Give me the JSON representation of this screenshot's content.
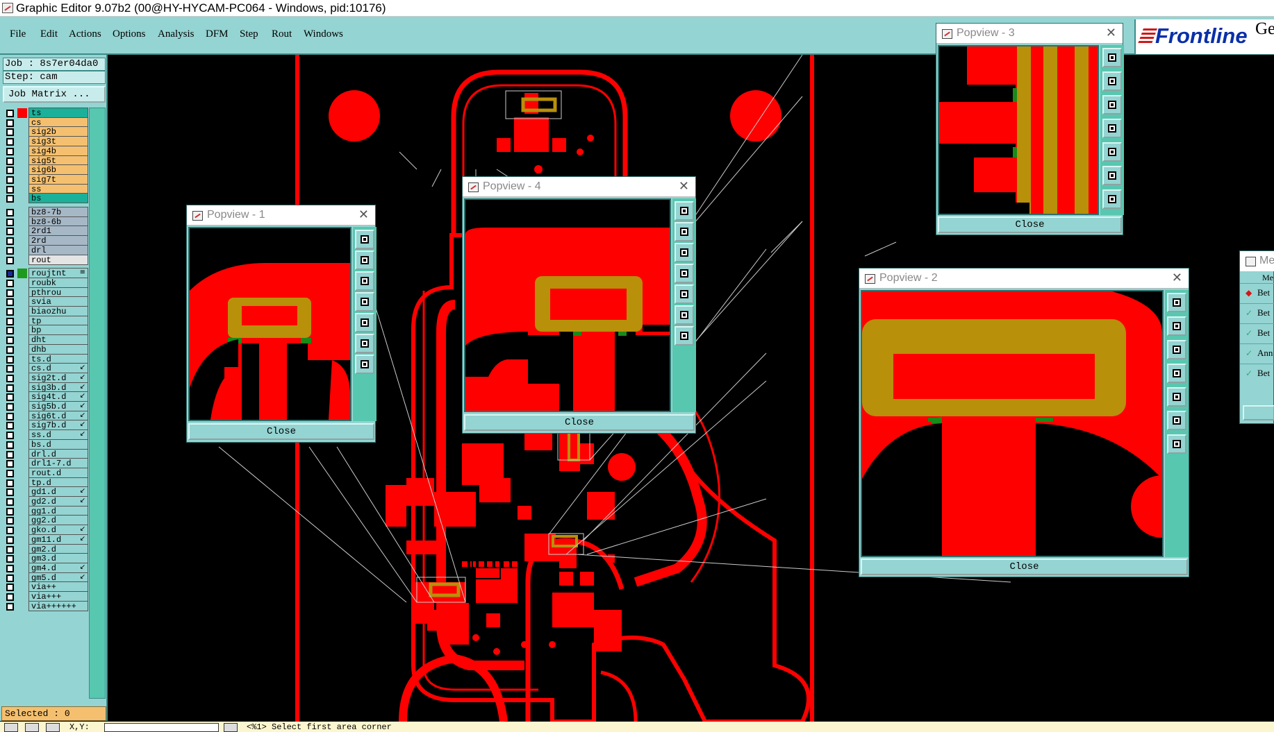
{
  "window": {
    "title": "Graphic Editor 9.07b2 (00@HY-HYCAM-PC064 - Windows, pid:10176)"
  },
  "menu": [
    {
      "label": "File"
    },
    {
      "label": "Edit"
    },
    {
      "label": "Actions"
    },
    {
      "label": "Options"
    },
    {
      "label": "Analysis"
    },
    {
      "label": "DFM"
    },
    {
      "label": "Step"
    },
    {
      "label": "Rout"
    },
    {
      "label": "Windows"
    }
  ],
  "brand": {
    "logo_text": "Frontline",
    "partial_text": "Ge"
  },
  "job": {
    "job_label": "Job : 8s7er04da0",
    "step_label": "Step: cam",
    "job_matrix_button": "Job Matrix ..."
  },
  "layers": [
    {
      "name": "ts",
      "color": "#1ab09a",
      "swatch": "#ff0000"
    },
    {
      "name": "cs",
      "color": "#f4c070",
      "swatch": ""
    },
    {
      "name": "sig2b",
      "color": "#f4c070",
      "swatch": ""
    },
    {
      "name": "sig3t",
      "color": "#f4c070",
      "swatch": ""
    },
    {
      "name": "sig4b",
      "color": "#f4c070",
      "swatch": ""
    },
    {
      "name": "sig5t",
      "color": "#f4c070",
      "swatch": ""
    },
    {
      "name": "sig6b",
      "color": "#f4c070",
      "swatch": ""
    },
    {
      "name": "sig7t",
      "color": "#f4c070",
      "swatch": ""
    },
    {
      "name": "ss",
      "color": "#f4c070",
      "swatch": ""
    },
    {
      "name": "bs",
      "color": "#1ab09a",
      "swatch": ""
    },
    {
      "name": "bz8-7b",
      "color": "#a6b8c6",
      "swatch": ""
    },
    {
      "name": "bz8-6b",
      "color": "#a6b8c6",
      "swatch": ""
    },
    {
      "name": "2rd1",
      "color": "#a6b8c6",
      "swatch": ""
    },
    {
      "name": "2rd",
      "color": "#a6b8c6",
      "swatch": ""
    },
    {
      "name": "drl",
      "color": "#a6b8c6",
      "swatch": ""
    },
    {
      "name": "rout",
      "color": "#e4e4e4",
      "swatch": ""
    },
    {
      "name": "roujtnt",
      "color": "#94d4d2",
      "swatch": "#1e9a1e",
      "mark": "≡",
      "checked": true
    },
    {
      "name": "roubk",
      "color": "#94d4d2",
      "swatch": ""
    },
    {
      "name": "pthrou",
      "color": "#94d4d2",
      "swatch": ""
    },
    {
      "name": "svia",
      "color": "#94d4d2",
      "swatch": ""
    },
    {
      "name": "biaozhu",
      "color": "#94d4d2",
      "swatch": ""
    },
    {
      "name": "tp",
      "color": "#94d4d2",
      "swatch": ""
    },
    {
      "name": "bp",
      "color": "#94d4d2",
      "swatch": ""
    },
    {
      "name": "dht",
      "color": "#94d4d2",
      "swatch": ""
    },
    {
      "name": "dhb",
      "color": "#94d4d2",
      "swatch": ""
    },
    {
      "name": "ts.d",
      "color": "#94d4d2",
      "swatch": ""
    },
    {
      "name": "cs.d",
      "color": "#94d4d2",
      "swatch": "",
      "mark": "↙"
    },
    {
      "name": "sig2t.d",
      "color": "#94d4d2",
      "swatch": "",
      "mark": "↙"
    },
    {
      "name": "sig3b.d",
      "color": "#94d4d2",
      "swatch": "",
      "mark": "↙"
    },
    {
      "name": "sig4t.d",
      "color": "#94d4d2",
      "swatch": "",
      "mark": "↙"
    },
    {
      "name": "sig5b.d",
      "color": "#94d4d2",
      "swatch": "",
      "mark": "↙"
    },
    {
      "name": "sig6t.d",
      "color": "#94d4d2",
      "swatch": "",
      "mark": "↙"
    },
    {
      "name": "sig7b.d",
      "color": "#94d4d2",
      "swatch": "",
      "mark": "↙"
    },
    {
      "name": "ss.d",
      "color": "#94d4d2",
      "swatch": "",
      "mark": "↙"
    },
    {
      "name": "bs.d",
      "color": "#94d4d2",
      "swatch": ""
    },
    {
      "name": "drl.d",
      "color": "#94d4d2",
      "swatch": ""
    },
    {
      "name": "drl1-7.d",
      "color": "#94d4d2",
      "swatch": ""
    },
    {
      "name": "rout.d",
      "color": "#94d4d2",
      "swatch": ""
    },
    {
      "name": "tp.d",
      "color": "#94d4d2",
      "swatch": ""
    },
    {
      "name": "gd1.d",
      "color": "#94d4d2",
      "swatch": "",
      "mark": "↙"
    },
    {
      "name": "gd2.d",
      "color": "#94d4d2",
      "swatch": "",
      "mark": "↙"
    },
    {
      "name": "gg1.d",
      "color": "#94d4d2",
      "swatch": ""
    },
    {
      "name": "gg2.d",
      "color": "#94d4d2",
      "swatch": ""
    },
    {
      "name": "gko.d",
      "color": "#94d4d2",
      "swatch": "",
      "mark": "↙"
    },
    {
      "name": "gm11.d",
      "color": "#94d4d2",
      "swatch": "",
      "mark": "↙"
    },
    {
      "name": "gm2.d",
      "color": "#94d4d2",
      "swatch": ""
    },
    {
      "name": "gm3.d",
      "color": "#94d4d2",
      "swatch": ""
    },
    {
      "name": "gm4.d",
      "color": "#94d4d2",
      "swatch": "",
      "mark": "↙"
    },
    {
      "name": "gm5.d",
      "color": "#94d4d2",
      "swatch": "",
      "mark": "↙"
    },
    {
      "name": "via++",
      "color": "#94d4d2",
      "swatch": ""
    },
    {
      "name": "via+++",
      "color": "#94d4d2",
      "swatch": ""
    },
    {
      "name": "via++++++",
      "color": "#94d4d2",
      "swatch": ""
    }
  ],
  "selected_label": "Selected : 0",
  "status": {
    "coord_label": "X,Y:",
    "message": "<%1>  Select first area corner"
  },
  "popviews": [
    {
      "id": "pv1",
      "title": "Popview - 1",
      "close_label": "Close"
    },
    {
      "id": "pv4",
      "title": "Popview - 4",
      "close_label": "Close"
    },
    {
      "id": "pv3",
      "title": "Popview - 3",
      "close_label": "Close"
    },
    {
      "id": "pv2",
      "title": "Popview - 2",
      "close_label": "Close"
    }
  ],
  "measure_panel": {
    "title": "Me",
    "header": "Me",
    "items": [
      {
        "label": "Bet",
        "icon": "diamond-icon"
      },
      {
        "label": "Bet",
        "icon": "check-icon"
      },
      {
        "label": "Bet",
        "icon": "check-icon"
      },
      {
        "label": "Ann",
        "icon": "check-icon"
      },
      {
        "label": "Bet",
        "icon": "check-icon"
      }
    ]
  },
  "colors": {
    "feature": "#ff0000",
    "gold": "#b8900a",
    "green": "#1a8a1a",
    "panel": "#94d4d2",
    "panel_dark": "#58c7b0"
  }
}
